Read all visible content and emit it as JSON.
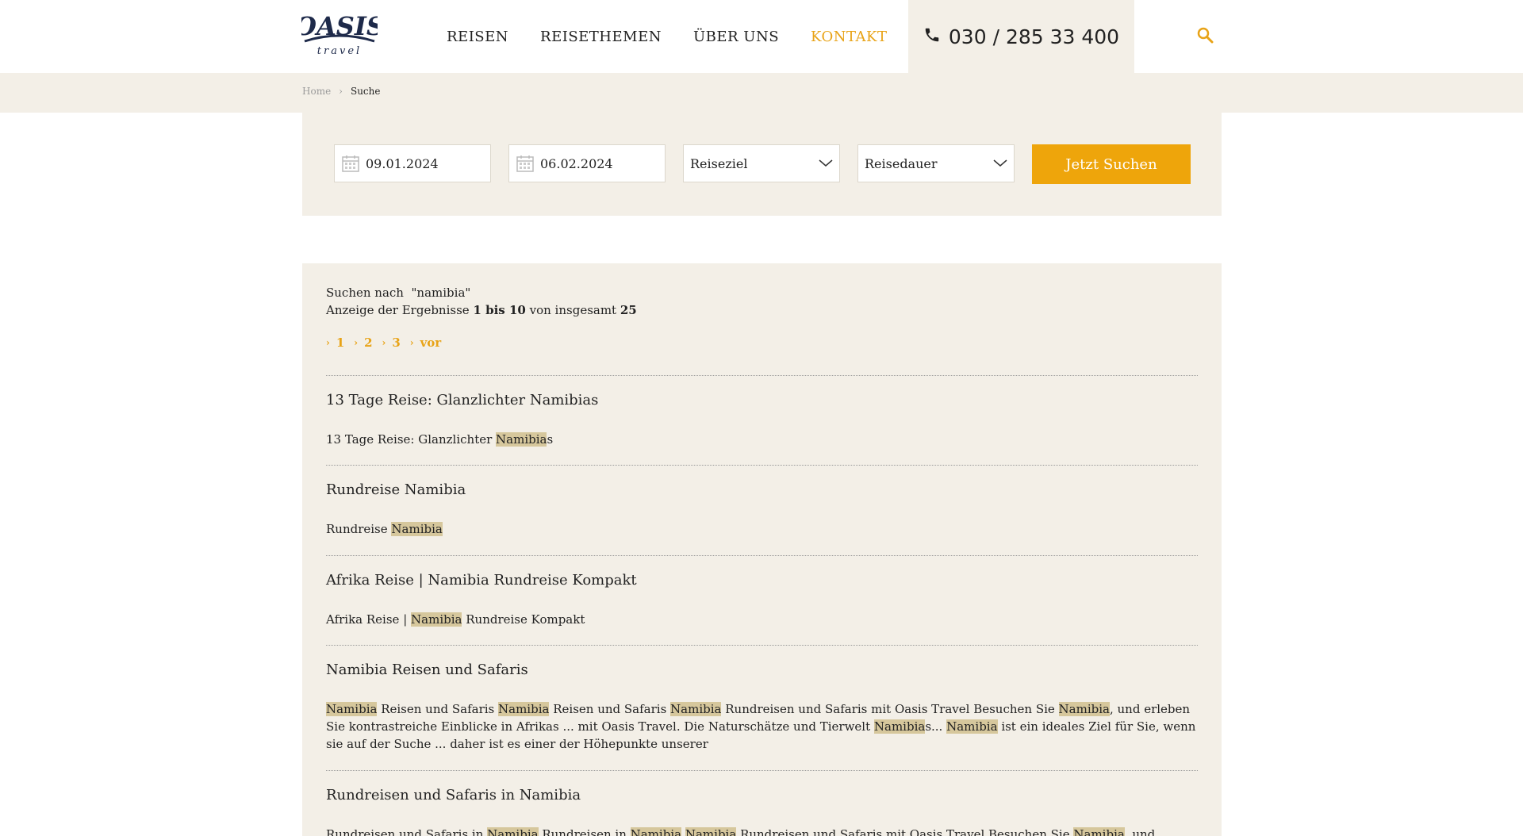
{
  "header": {
    "logo": {
      "main": "OASIS",
      "sub": "travel"
    },
    "nav": [
      {
        "label": "REISEN",
        "active": false
      },
      {
        "label": "REISETHEMEN",
        "active": false
      },
      {
        "label": "ÜBER UNS",
        "active": false
      },
      {
        "label": "KONTAKT",
        "active": true
      }
    ],
    "phone": "030 / 285 33 400",
    "icons": {
      "phone": "phone-icon",
      "search": "search-icon"
    }
  },
  "breadcrumb": {
    "home": "Home",
    "current": "Suche"
  },
  "search": {
    "date_from": "09.01.2024",
    "date_to": "06.02.2024",
    "destination": "Reiseziel",
    "duration": "Reisedauer",
    "button": "Jetzt Suchen"
  },
  "results": {
    "query_prefix": "Suchen nach",
    "query": "\"namibia\"",
    "count_prefix": "Anzeige der Ergebnisse",
    "count_range": "1 bis 10",
    "count_mid": "von insgesamt",
    "count_total": "25",
    "pages": [
      "1",
      "2",
      "3",
      "vor"
    ],
    "items": [
      {
        "title": "13 Tage Reise: Glanzlichter Namibias",
        "snippet_html": "13 Tage Reise: Glanzlichter <mark>Namibia</mark>s"
      },
      {
        "title": "Rundreise Namibia",
        "snippet_html": "Rundreise <mark>Namibia</mark>"
      },
      {
        "title": "Afrika Reise | Namibia Rundreise Kompakt",
        "snippet_html": "Afrika Reise | <mark>Namibia</mark> Rundreise Kompakt"
      },
      {
        "title": "Namibia Reisen und Safaris",
        "snippet_html": "<mark>Namibia</mark> Reisen und Safaris <mark>Namibia</mark> Reisen und Safaris <mark>Namibia</mark> Rundreisen und Safaris mit Oasis Travel Besuchen Sie <mark>Namibia</mark>, und erleben Sie kontrastreiche Einblicke in Afrikas ... mit Oasis Travel. Die Naturschätze und Tierwelt <mark>Namibia</mark>s... <mark>Namibia</mark> ist ein ideales Ziel für Sie, wenn sie auf der Suche ... daher ist es einer der Höhepunkte unserer"
      },
      {
        "title": "Rundreisen und Safaris in Namibia",
        "snippet_html": "Rundreisen und Safaris in <mark>Namibia</mark> Rundreisen in <mark>Namibia</mark> <mark>Namibia</mark> Rundreisen und Safaris mit Oasis Travel Besuchen Sie <mark>Namibia</mark>, und erleben Sie"
      }
    ]
  },
  "colors": {
    "accent": "#e8a317",
    "button": "#eea50b",
    "band": "#f3efe7",
    "highlight": "#d6c79c"
  }
}
